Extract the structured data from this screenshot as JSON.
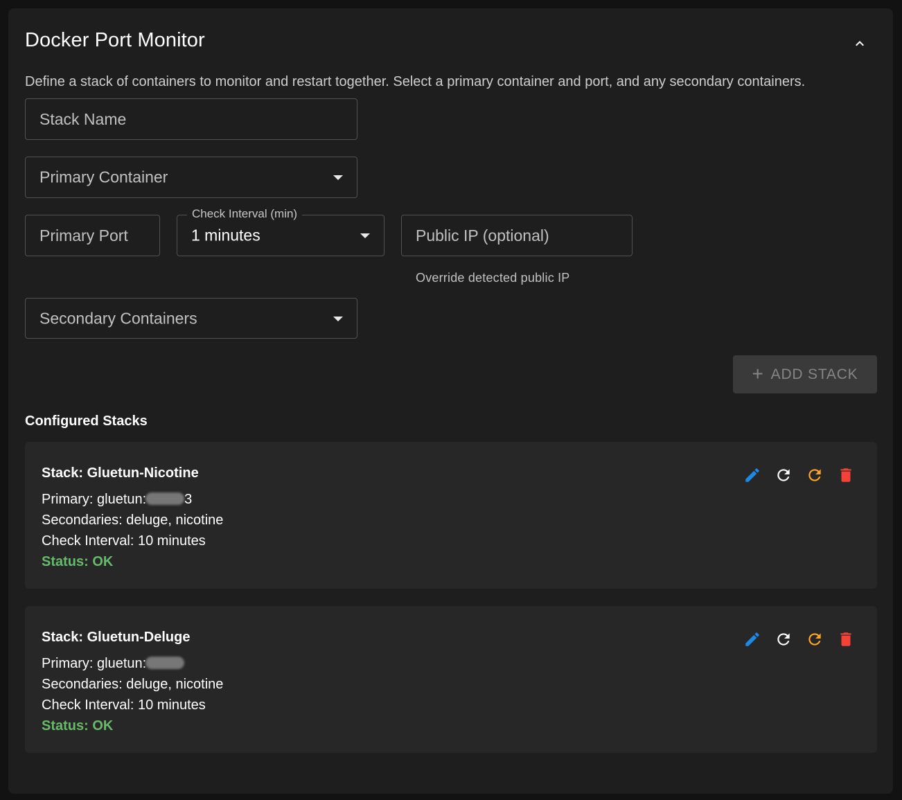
{
  "header": {
    "title": "Docker Port Monitor",
    "description": "Define a stack of containers to monitor and restart together. Select a primary container and port, and any secondary containers."
  },
  "form": {
    "stack_name_placeholder": "Stack Name",
    "primary_container_placeholder": "Primary Container",
    "primary_port_placeholder": "Primary Port",
    "check_interval_label": "Check Interval (min)",
    "check_interval_value": "1 minutes",
    "public_ip_placeholder": "Public IP (optional)",
    "public_ip_helper": "Override detected public IP",
    "secondary_containers_placeholder": "Secondary Containers",
    "add_button_label": "ADD STACK"
  },
  "configured": {
    "title": "Configured Stacks",
    "stacks": [
      {
        "name": "Stack: Gluetun-Nicotine",
        "primary_prefix": "Primary: gluetun:",
        "primary_suffix": "3",
        "secondaries": "Secondaries: deluge, nicotine",
        "interval": "Check Interval: 10 minutes",
        "status": "Status: OK"
      },
      {
        "name": "Stack: Gluetun-Deluge",
        "primary_prefix": "Primary: gluetun:",
        "primary_suffix": "",
        "secondaries": "Secondaries: deluge, nicotine",
        "interval": "Check Interval: 10 minutes",
        "status": "Status: OK"
      }
    ]
  },
  "colors": {
    "edit": "#1e88e5",
    "refresh": "#ffffff",
    "restart": "#ffa726",
    "delete": "#f44336",
    "status_ok": "#66bb6a"
  },
  "icons": [
    "chevron-up-icon",
    "plus-icon",
    "pencil-icon",
    "refresh-icon",
    "restart-icon",
    "trash-icon"
  ]
}
